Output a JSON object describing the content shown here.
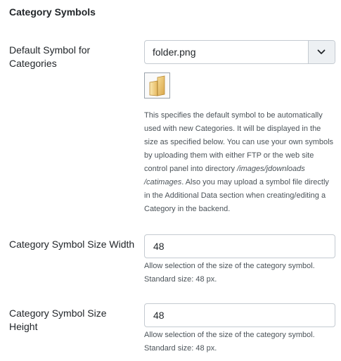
{
  "section": {
    "title": "Category Symbols"
  },
  "default_symbol": {
    "label": "Default Symbol for Categories",
    "selected": "folder.png",
    "dropdown_icon": "chevron-down-icon",
    "preview_icon": "folder-icon",
    "help": {
      "part1": "This specifies the default symbol to be automatically used with new Categories. It will be displayed in the size as specified below. You can use your own symbols by uploading them with either FTP or the web site control panel into directory ",
      "path": "/images/jdownloads /catimages",
      "part2": ". Also you may upload a symbol file directly in the Additional Data section when creating/editing a Category in the backend."
    }
  },
  "size_width": {
    "label": "Category Symbol Size Width",
    "value": "48",
    "help": "Allow selection of the size of the category symbol. Standard size: 48 px."
  },
  "size_height": {
    "label": "Category Symbol Size Height",
    "value": "48",
    "help": "Allow selection of the size of the category symbol. Standard size: 48 px."
  }
}
